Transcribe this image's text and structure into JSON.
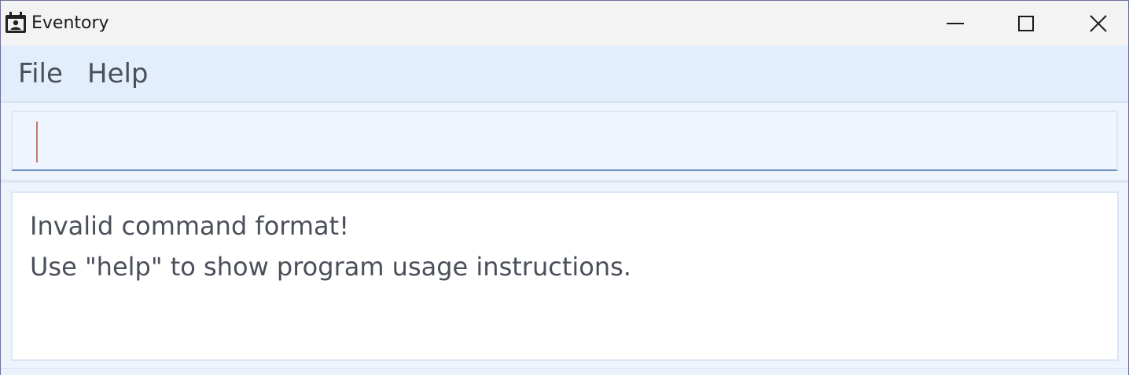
{
  "window": {
    "title": "Eventory",
    "icon": "calendar-contact-icon",
    "controls": {
      "minimize": "minimize-icon",
      "maximize": "maximize-icon",
      "close": "close-icon"
    }
  },
  "menubar": {
    "items": [
      {
        "label": "File"
      },
      {
        "label": "Help"
      }
    ]
  },
  "command": {
    "value": "",
    "placeholder": ""
  },
  "result": {
    "lines": [
      "Invalid command format!",
      "Use \"help\" to show program usage instructions."
    ]
  },
  "colors": {
    "titlebar_bg": "#f3f3f3",
    "menubar_bg": "#e3eefc",
    "command_underline": "#6a8dc4",
    "caret": "#c47a6a",
    "text": "#4a4f59"
  }
}
